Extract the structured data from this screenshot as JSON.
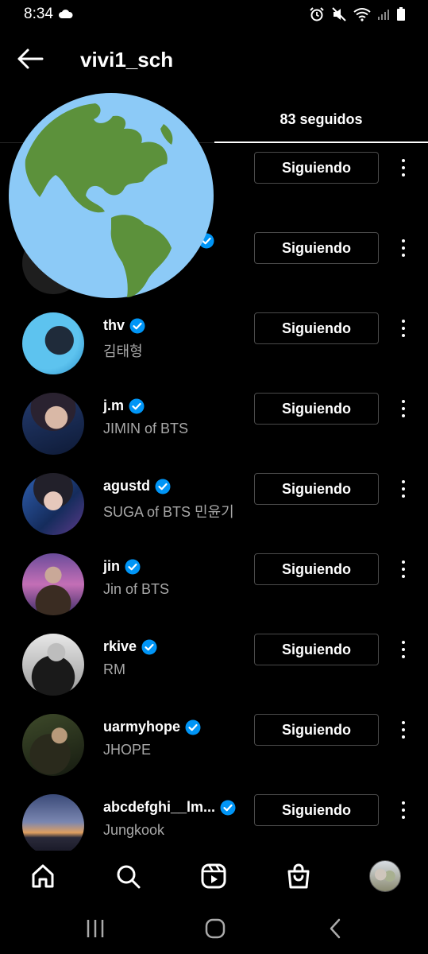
{
  "status_bar": {
    "time": "8:34",
    "icons": [
      "cloud-icon",
      "alarm-icon",
      "mute-icon",
      "wifi-icon",
      "signal-icon",
      "battery-icon"
    ]
  },
  "header": {
    "username": "vivi1_sch",
    "back_icon": "arrow-left-icon"
  },
  "tabs": {
    "following_label": "83 seguidos"
  },
  "overlay": {
    "icon": "globe-americas-icon"
  },
  "accent_color": "#0095f6",
  "following_list": [
    {
      "username": "",
      "fullname": "",
      "verified": false,
      "button": "Siguiendo"
    },
    {
      "username": "",
      "fullname": "",
      "verified": true,
      "button": "Siguiendo"
    },
    {
      "username": "thv",
      "fullname": "김태형",
      "verified": true,
      "button": "Siguiendo"
    },
    {
      "username": "j.m",
      "fullname": "JIMIN of BTS",
      "verified": true,
      "button": "Siguiendo"
    },
    {
      "username": "agustd",
      "fullname": "SUGA of BTS 민윤기",
      "verified": true,
      "button": "Siguiendo"
    },
    {
      "username": "jin",
      "fullname": "Jin of BTS",
      "verified": true,
      "button": "Siguiendo"
    },
    {
      "username": "rkive",
      "fullname": "RM",
      "verified": true,
      "button": "Siguiendo"
    },
    {
      "username": "uarmyhope",
      "fullname": "JHOPE",
      "verified": true,
      "button": "Siguiendo"
    },
    {
      "username": "abcdefghi__lm...",
      "fullname": "Jungkook",
      "verified": true,
      "button": "Siguiendo"
    }
  ],
  "bottom_nav": [
    "home-icon",
    "search-icon",
    "reels-icon",
    "shop-icon",
    "profile-avatar"
  ],
  "system_nav": [
    "recent-apps-icon",
    "home-circle-icon",
    "back-chevron-icon"
  ]
}
